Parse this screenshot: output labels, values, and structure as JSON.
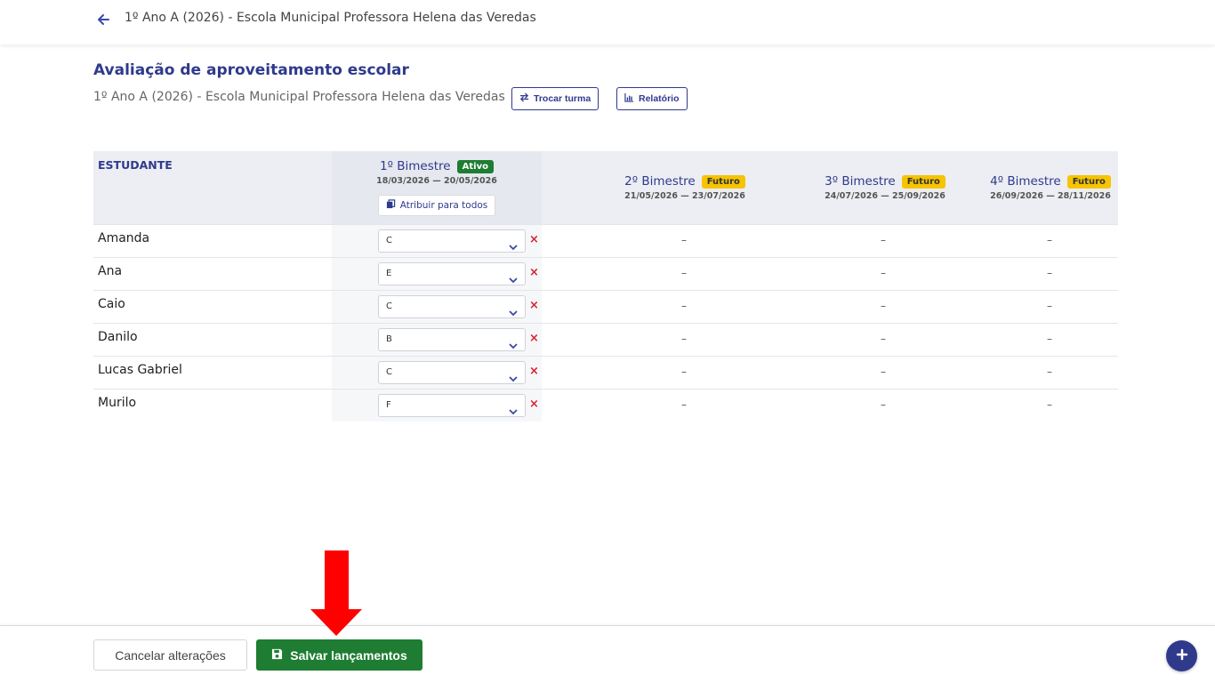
{
  "topbar": {
    "title": "1º Ano A (2026) - Escola Municipal Professora Helena das Veredas"
  },
  "header": {
    "title": "Avaliação de aproveitamento escolar",
    "subtitle": "1º Ano A (2026) - Escola Municipal Professora Helena das Veredas",
    "switch_class_label": "Trocar turma",
    "report_label": "Relatório"
  },
  "table": {
    "student_header": "ESTUDANTE",
    "bimesters": [
      {
        "title": "1º Bimestre",
        "badge": "Ativo",
        "dates": "18/03/2026 — 20/05/2026",
        "assign_label": "Atribuir para todos"
      },
      {
        "title": "2º Bimestre",
        "badge": "Futuro",
        "dates": "21/05/2026 — 23/07/2026"
      },
      {
        "title": "3º Bimestre",
        "badge": "Futuro",
        "dates": "24/07/2026 — 25/09/2026"
      },
      {
        "title": "4º Bimestre",
        "badge": "Futuro",
        "dates": "26/09/2026 — 28/11/2026"
      }
    ],
    "empty_marker": "–",
    "rows": [
      {
        "name": "Amanda",
        "grade": "C"
      },
      {
        "name": "Ana",
        "grade": "E"
      },
      {
        "name": "Caio",
        "grade": "C"
      },
      {
        "name": "Danilo",
        "grade": "B"
      },
      {
        "name": "Lucas Gabriel",
        "grade": "C"
      },
      {
        "name": "Murilo",
        "grade": "F"
      }
    ]
  },
  "footer": {
    "cancel_label": "Cancelar alterações",
    "save_label": "Salvar lançamentos"
  },
  "colors": {
    "primary": "#2f3a8c",
    "success": "#1e7d32",
    "warning": "#f6c400",
    "danger": "#d8212f",
    "annotation_arrow": "#ff0000"
  },
  "icons": [
    "arrow-left-icon",
    "swap-icon",
    "chart-icon",
    "copy-icon",
    "chevron-down-icon",
    "close-icon",
    "save-icon",
    "plus-icon"
  ]
}
